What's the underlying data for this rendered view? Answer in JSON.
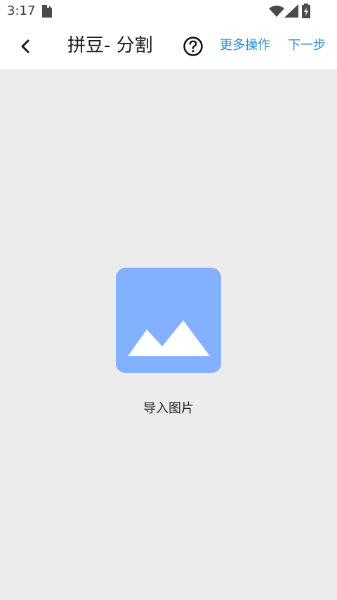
{
  "status_bar": {
    "time": "3:17",
    "icons": [
      "sim-card-icon",
      "wifi-icon",
      "cellular-signal-icon",
      "battery-charging-icon"
    ]
  },
  "app_bar": {
    "back_icon": "chevron-left-icon",
    "title": "拼豆- 分割",
    "help_icon": "question-circle-icon",
    "more_actions_label": "更多操作",
    "next_step_label": "下一步",
    "accent_color": "#2e8cd6"
  },
  "main": {
    "placeholder_icon": "image-placeholder-icon",
    "placeholder_color": "#84b1ff",
    "import_label": "导入图片",
    "background_color": "#ececec"
  }
}
